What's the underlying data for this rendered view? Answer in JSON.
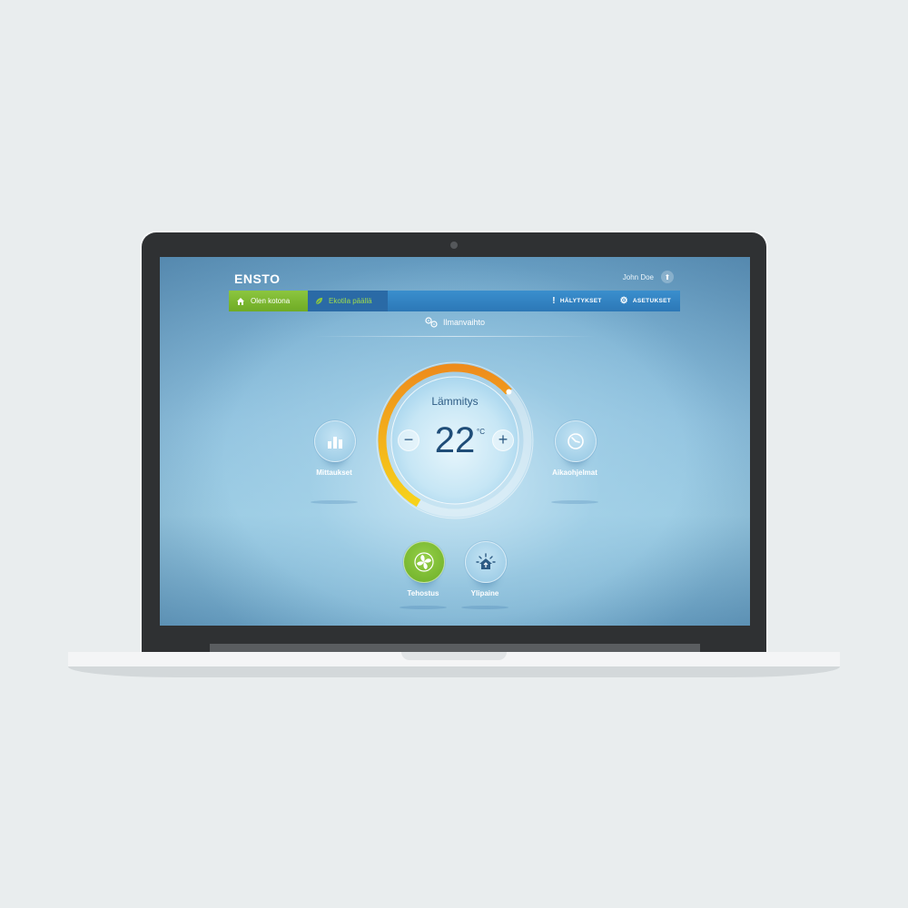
{
  "brand": {
    "logo": "ENSTO"
  },
  "user": {
    "name": "John Doe"
  },
  "navbar": {
    "home_label": "Olen kotona",
    "eco_label": "Ekotila päällä",
    "alerts_label": "HÄLYTYKSET",
    "settings_label": "ASETUKSET"
  },
  "section": {
    "title": "Ilmanvaihto"
  },
  "thermostat": {
    "mode": "Lämmitys",
    "temperature": "22",
    "unit": "°C",
    "minus": "−",
    "plus": "+",
    "level": 0.55
  },
  "buttons": {
    "measurements": "Mittaukset",
    "schedules": "Aikaohjelmat",
    "boost": "Tehostus",
    "overpressure": "Ylipaine"
  },
  "colors": {
    "brand_green": "#8cc63f",
    "nav_blue": "#3a8fcd",
    "dial_orange": "#f29a1b",
    "dial_yellow": "#f6c61a",
    "text_dark_blue": "#1f4d78"
  },
  "icons": {
    "home": "home-icon",
    "leaf": "leaf-icon",
    "alert": "exclamation-icon",
    "gear": "gear-icon",
    "fan": "fan-icon",
    "chart": "bar-chart-icon",
    "clock": "clock-icon",
    "boost": "fan-boost-icon",
    "house_pressure": "house-pressure-icon",
    "user_arrow": "arrow-up-icon"
  }
}
